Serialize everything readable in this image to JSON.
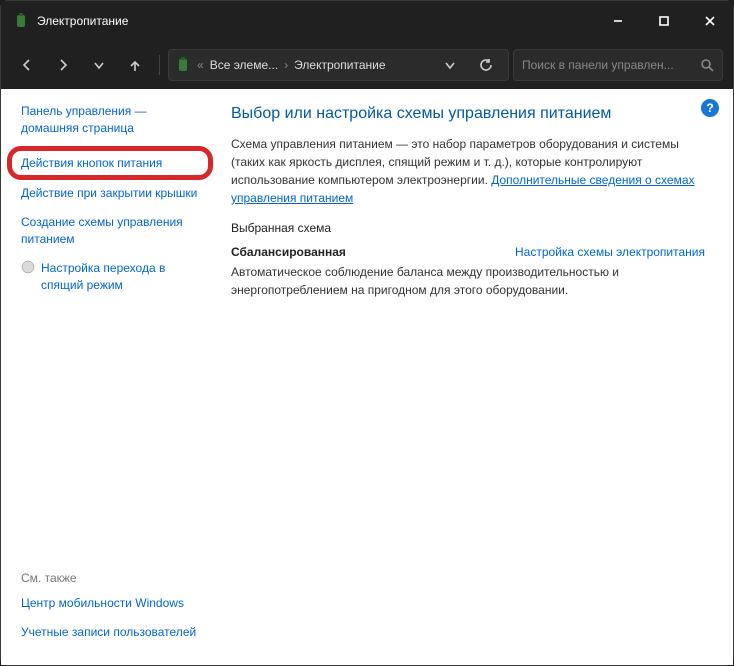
{
  "window": {
    "title": "Электропитание"
  },
  "breadcrumb": {
    "seg1": "Все элеме...",
    "seg2": "Электропитание"
  },
  "search": {
    "placeholder": "Поиск в панели управлен..."
  },
  "sidebar": {
    "home": "Панель управления — домашняя страница",
    "buttons_action": "Действия кнопок питания",
    "lid_action": "Действие при закрытии крышки",
    "create_plan": "Создание схемы управления питанием",
    "sleep_settings": "Настройка перехода в спящий режим",
    "see_also_label": "См. также",
    "mobility_center": "Центр мобильности Windows",
    "user_accounts": "Учетные записи пользователей"
  },
  "main": {
    "heading": "Выбор или настройка схемы управления питанием",
    "description": "Схема управления питанием — это набор параметров оборудования и системы (таких как яркость дисплея, спящий режим и т. д.), которые контролируют использование компьютером электроэнергии. ",
    "more_info_link": "Дополнительные сведения о схемах управления питанием",
    "selected_label": "Выбранная схема",
    "plan_name": "Сбалансированная",
    "plan_settings_link": "Настройка схемы электропитания",
    "plan_description": "Автоматическое соблюдение баланса между производительностью и энергопотреблением на пригодном для этого оборудовании."
  }
}
